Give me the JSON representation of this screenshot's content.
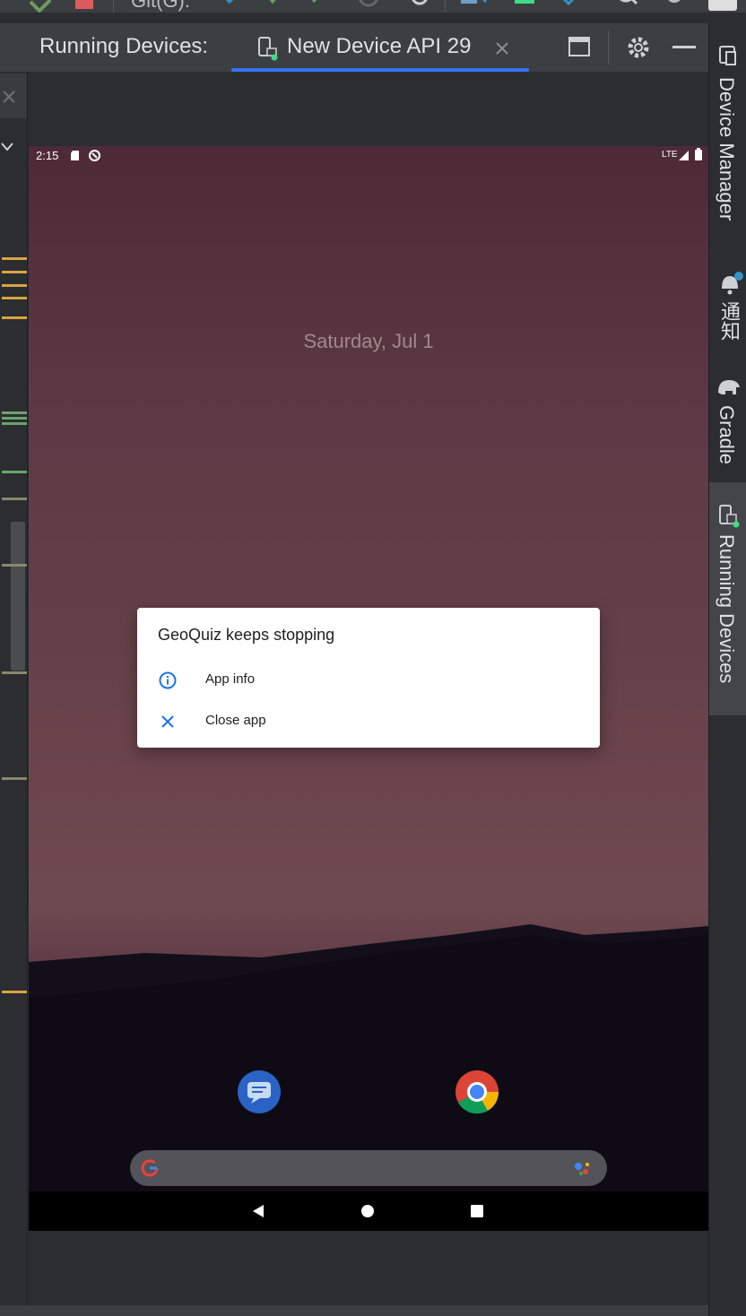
{
  "toolbar": {
    "git_label": "Git(G):"
  },
  "tool_window": {
    "title": "Running Devices:",
    "tab_label": "New Device API 29"
  },
  "right_stripe": {
    "device_manager": "Device Manager",
    "notifications": "通知",
    "gradle": "Gradle",
    "running_devices": "Running Devices"
  },
  "device": {
    "status_time": "2:15",
    "network": "LTE",
    "date": "Saturday, Jul 1",
    "dialog": {
      "title": "GeoQuiz keeps stopping",
      "app_info": "App info",
      "close_app": "Close app"
    }
  },
  "colors": {
    "accent": "#3574f0",
    "dialog_icon": "#1a73e8",
    "ide_background": "#2b2d30"
  }
}
